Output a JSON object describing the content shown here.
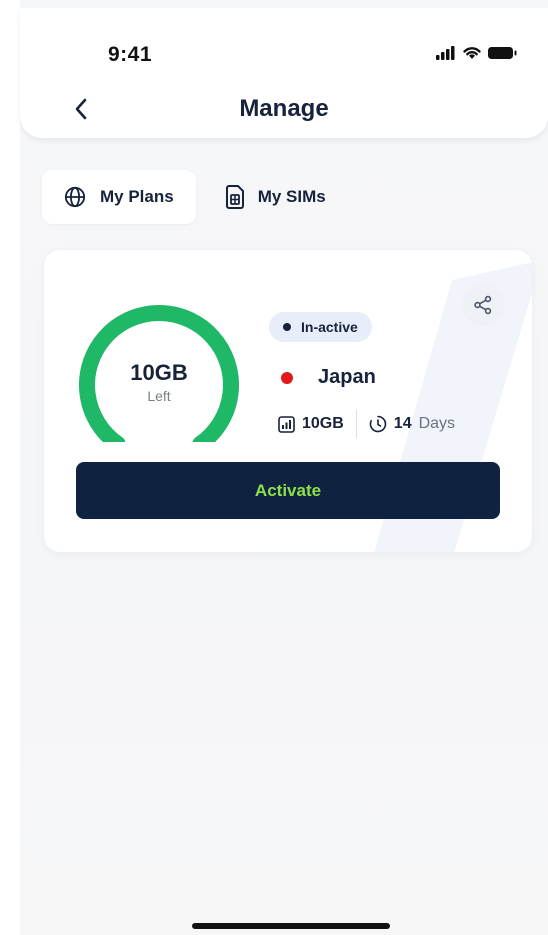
{
  "status_bar": {
    "time": "9:41"
  },
  "header": {
    "title": "Manage"
  },
  "tabs": [
    {
      "label": "My Plans",
      "icon": "globe-icon",
      "active": true
    },
    {
      "label": "My SIMs",
      "icon": "sim-card-icon",
      "active": false
    }
  ],
  "plan_card": {
    "remaining_value": "10GB",
    "remaining_label": "Left",
    "remaining_fraction": 1.0,
    "status": "In-active",
    "country": "Japan",
    "flag_icon": "japan-flag-icon",
    "data_amount": "10GB",
    "validity_number": "14",
    "validity_unit": "Days",
    "action_label": "Activate"
  },
  "colors": {
    "gauge": "#1fb866",
    "button_bg": "#0f2340",
    "button_text": "#8ee04a",
    "badge_bg": "#e7eef9",
    "text_primary": "#17223b"
  }
}
